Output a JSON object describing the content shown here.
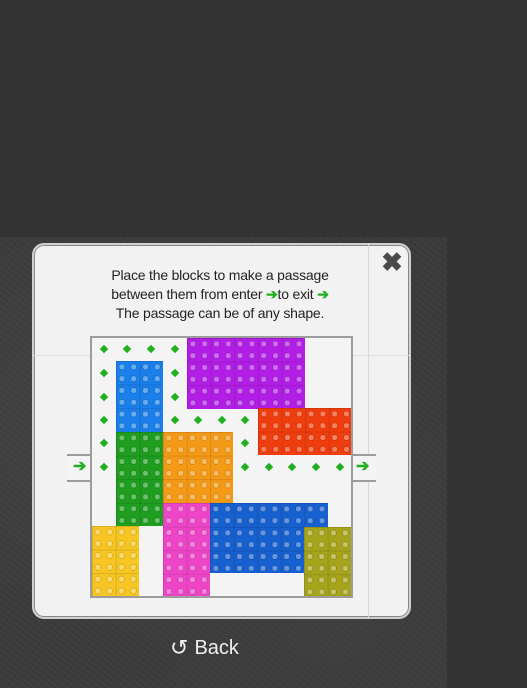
{
  "instructions": {
    "line1": "Place the blocks to make a passage",
    "line2_a": "between them from enter",
    "line2_b": "to exit",
    "line3": "The passage can be of any shape."
  },
  "close_label": "✖",
  "arrow_glyph": "➔",
  "back_label": "Back",
  "back_icon": "↺",
  "colors": {
    "purple": "#b21ee6",
    "blue": "#1a7fea",
    "red": "#f03d0d",
    "green": "#1f9e1f",
    "orange": "#f59a16",
    "pink": "#ee45c8",
    "darkblue": "#1760cf",
    "yellow": "#f7c622",
    "olive": "#a6a41a",
    "path": "#22b022"
  },
  "blocks": [
    "purple",
    "blue",
    "red",
    "green",
    "orange",
    "pink",
    "darkblue",
    "yellow",
    "olive"
  ]
}
